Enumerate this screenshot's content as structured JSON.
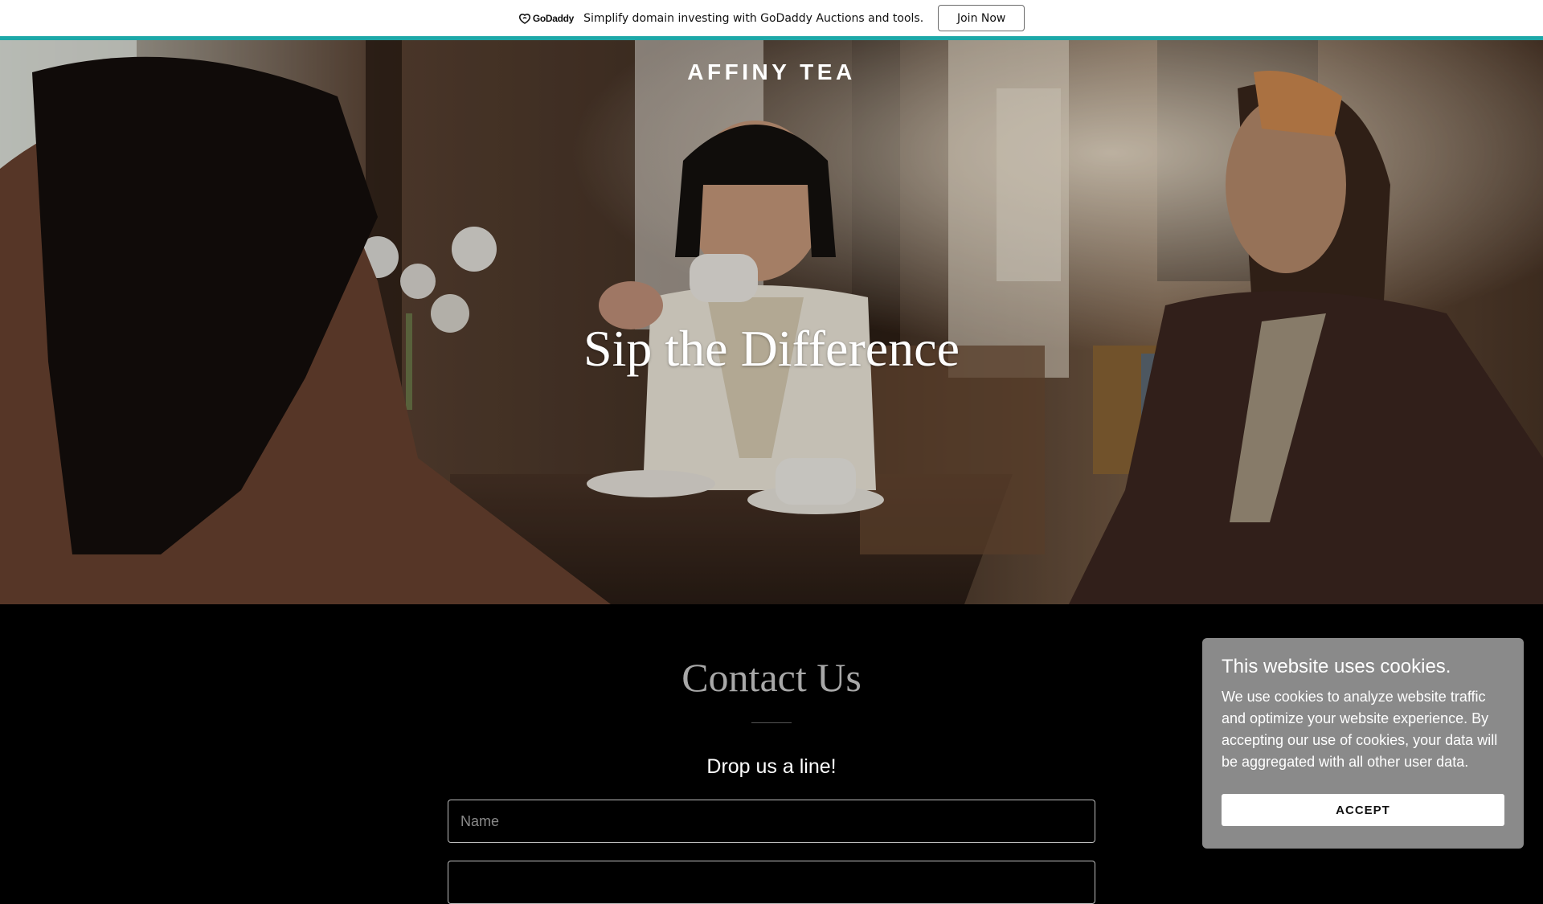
{
  "promo_bar": {
    "logo_text": "GoDaddy",
    "message": "Simplify domain investing with GoDaddy Auctions and tools.",
    "join_label": "Join Now",
    "accent_color": "#1da8a8"
  },
  "hero": {
    "brand": "AFFINY TEA",
    "title": "Sip the Difference",
    "image_description": "three women laughing over tea at a café table"
  },
  "contact": {
    "title": "Contact Us",
    "subtitle": "Drop us a line!",
    "name_placeholder": "Name"
  },
  "cookie_banner": {
    "title": "This website uses cookies.",
    "body": "We use cookies to analyze website traffic and optimize your website experience. By accepting our use of cookies, your data will be aggregated with all other user data.",
    "accept_label": "ACCEPT"
  }
}
